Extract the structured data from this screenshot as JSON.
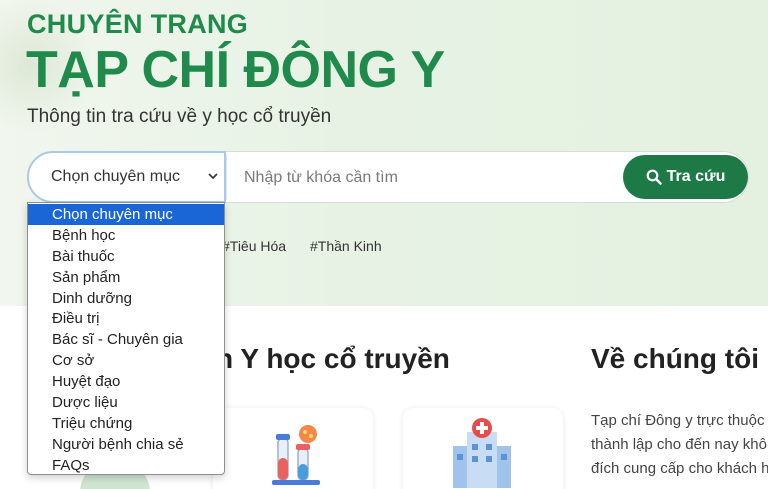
{
  "hero": {
    "kicker": "CHUYÊN TRANG",
    "title": "TẠP CHÍ ĐÔNG Y",
    "subtitle": "Thông tin tra cứu về y học cổ truyền"
  },
  "search": {
    "select_value": "Chọn chuyên mục",
    "placeholder": "Nhập từ khóa cần tìm",
    "button_label": "Tra cứu"
  },
  "dropdown": {
    "options": [
      "Chọn chuyên mục",
      "Bệnh học",
      "Bài thuốc",
      "Sản phẩm",
      "Dinh dưỡng",
      "Điều trị",
      "Bác sĩ - Chuyên gia",
      "Cơ sở",
      "Huyệt đạo",
      "Dược liệu",
      "Triệu chứng",
      "Người bệnh chia sẻ",
      "FAQs"
    ],
    "selected_index": 0
  },
  "tags": [
    "#Tiêu Hóa",
    "#Thần Kinh"
  ],
  "sections": {
    "knowledge_title_partial": "n Y học cổ truyền",
    "about_title": "Về chúng tôi"
  },
  "about": {
    "lines": [
      "Tạp chí Đông y trực thuộc",
      "thành lập cho đến nay khô",
      "đích cung cấp cho khách h"
    ]
  },
  "colors": {
    "brand_green": "#1f8a4c",
    "button_green": "#1d7a47",
    "selection_blue": "#1a66d6"
  },
  "icons": [
    "search-icon",
    "chevron-down-icon",
    "test-tube-icon",
    "hospital-icon"
  ]
}
